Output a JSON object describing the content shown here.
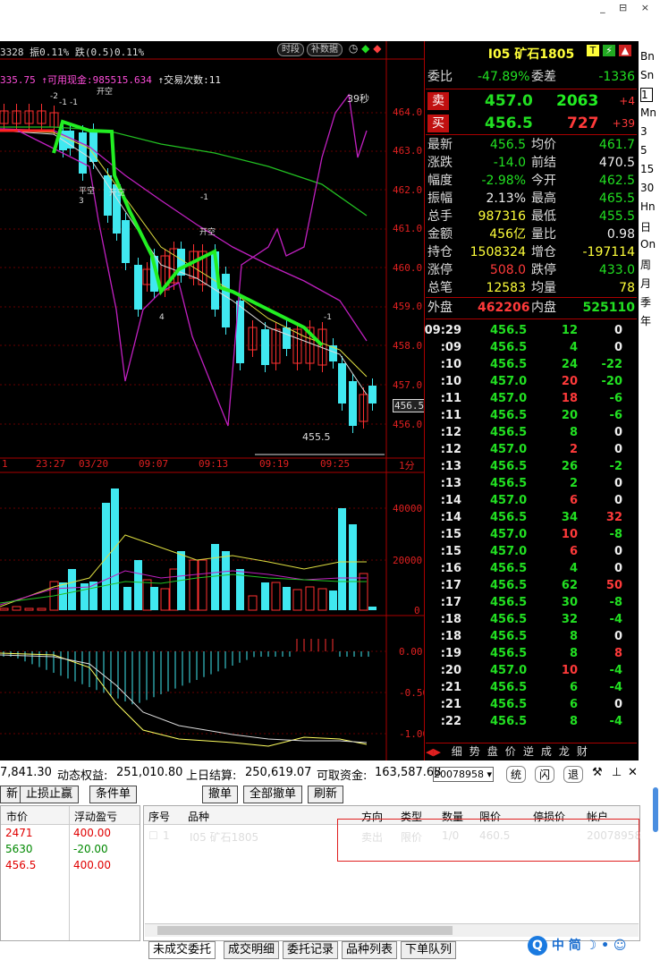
{
  "ticker": {
    "text": "3328 振0.11% 跌(0.5)0.11%",
    "btn_period": "时段",
    "btn_fill": "补数据"
  },
  "account": {
    "a": "335.75",
    "cash_label": "↑可用现金:",
    "cash": "985515.634",
    "trades_label": "↑交易次数:",
    "trades": "11"
  },
  "chart": {
    "y_labels": [
      "464.0",
      "463.0",
      "462.0",
      "461.0",
      "460.0",
      "459.0",
      "458.0",
      "457.0",
      "456.5",
      "456.0"
    ],
    "x_labels": [
      "1",
      "23:27",
      "03/20",
      "09:07",
      "09:13",
      "09:19",
      "09:25",
      "1分"
    ],
    "annot_39": "39秒",
    "annot_low": "455.5",
    "vol_labels": [
      "40000",
      "20000",
      "0"
    ],
    "macd_labels": [
      "0.00",
      "-0.50",
      "-1.00"
    ],
    "trade_marks": [
      "开空",
      "平空",
      "开空",
      "开空"
    ],
    "mark_numbers": [
      "-2",
      "-1",
      "-1",
      "3",
      "4",
      "-1",
      "-1"
    ]
  },
  "quote": {
    "title": "I05 矿石1805",
    "rows": [
      {
        "l1": "委比",
        "v1": "-47.89%",
        "l2": "委差",
        "v2": "-1336",
        "c1": "grn",
        "c2": "grn"
      }
    ],
    "sell": {
      "label": "卖",
      "price": "457.0",
      "vol": "2063",
      "chg": "+4"
    },
    "buy": {
      "label": "买",
      "price": "456.5",
      "vol": "727",
      "chg": "+39"
    },
    "stats": [
      {
        "l1": "最新",
        "v1": "456.5",
        "c1": "grn",
        "l2": "均价",
        "v2": "461.7",
        "c2": "grn"
      },
      {
        "l1": "涨跌",
        "v1": "-14.0",
        "c1": "grn",
        "l2": "前结",
        "v2": "470.5",
        "c2": "wht"
      },
      {
        "l1": "幅度",
        "v1": "-2.98%",
        "c1": "grn",
        "l2": "今开",
        "v2": "462.5",
        "c2": "grn"
      },
      {
        "l1": "振幅",
        "v1": "2.13%",
        "c1": "wht",
        "l2": "最高",
        "v2": "465.5",
        "c2": "grn"
      },
      {
        "l1": "总手",
        "v1": "987316",
        "c1": "yel",
        "l2": "最低",
        "v2": "455.5",
        "c2": "grn"
      },
      {
        "l1": "金额",
        "v1": "456亿",
        "c1": "yel",
        "l2": "量比",
        "v2": "0.98",
        "c2": "wht"
      },
      {
        "l1": "持仓",
        "v1": "1508324",
        "c1": "yel",
        "l2": "增仓",
        "v2": "-197114",
        "c2": "yel"
      },
      {
        "l1": "涨停",
        "v1": "508.0",
        "c1": "red",
        "l2": "跌停",
        "v2": "433.0",
        "c2": "grn"
      },
      {
        "l1": "总笔",
        "v1": "12583",
        "c1": "yel",
        "l2": "均量",
        "v2": "78",
        "c2": "yel"
      }
    ],
    "outer": {
      "l1": "外盘",
      "v1": "462206",
      "l2": "内盘",
      "v2": "525110"
    },
    "ticks": [
      {
        "t": "09:29",
        "p": "456.5",
        "pc": "grn",
        "v": "12",
        "vc": "grn",
        "d": "0",
        "dc": "wht"
      },
      {
        "t": ":09",
        "p": "456.5",
        "pc": "grn",
        "v": "4",
        "vc": "grn",
        "d": "0",
        "dc": "wht"
      },
      {
        "t": ":10",
        "p": "456.5",
        "pc": "grn",
        "v": "24",
        "vc": "grn",
        "d": "-22",
        "dc": "grn"
      },
      {
        "t": ":10",
        "p": "457.0",
        "pc": "grn",
        "v": "20",
        "vc": "red",
        "d": "-20",
        "dc": "grn"
      },
      {
        "t": ":11",
        "p": "457.0",
        "pc": "grn",
        "v": "18",
        "vc": "red",
        "d": "-6",
        "dc": "grn"
      },
      {
        "t": ":11",
        "p": "456.5",
        "pc": "grn",
        "v": "20",
        "vc": "grn",
        "d": "-6",
        "dc": "grn"
      },
      {
        "t": ":12",
        "p": "456.5",
        "pc": "grn",
        "v": "8",
        "vc": "grn",
        "d": "0",
        "dc": "wht"
      },
      {
        "t": ":12",
        "p": "457.0",
        "pc": "grn",
        "v": "2",
        "vc": "red",
        "d": "0",
        "dc": "wht"
      },
      {
        "t": ":13",
        "p": "456.5",
        "pc": "grn",
        "v": "26",
        "vc": "grn",
        "d": "-2",
        "dc": "grn"
      },
      {
        "t": ":13",
        "p": "456.5",
        "pc": "grn",
        "v": "2",
        "vc": "grn",
        "d": "0",
        "dc": "wht"
      },
      {
        "t": ":14",
        "p": "457.0",
        "pc": "grn",
        "v": "6",
        "vc": "red",
        "d": "0",
        "dc": "wht"
      },
      {
        "t": ":14",
        "p": "456.5",
        "pc": "grn",
        "v": "34",
        "vc": "grn",
        "d": "32",
        "dc": "red"
      },
      {
        "t": ":15",
        "p": "457.0",
        "pc": "grn",
        "v": "10",
        "vc": "red",
        "d": "-8",
        "dc": "grn"
      },
      {
        "t": ":15",
        "p": "457.0",
        "pc": "grn",
        "v": "6",
        "vc": "red",
        "d": "0",
        "dc": "wht"
      },
      {
        "t": ":16",
        "p": "456.5",
        "pc": "grn",
        "v": "4",
        "vc": "grn",
        "d": "0",
        "dc": "wht"
      },
      {
        "t": ":17",
        "p": "456.5",
        "pc": "grn",
        "v": "62",
        "vc": "grn",
        "d": "50",
        "dc": "red"
      },
      {
        "t": ":17",
        "p": "456.5",
        "pc": "grn",
        "v": "30",
        "vc": "grn",
        "d": "-8",
        "dc": "grn"
      },
      {
        "t": ":18",
        "p": "456.5",
        "pc": "grn",
        "v": "32",
        "vc": "grn",
        "d": "-4",
        "dc": "grn"
      },
      {
        "t": ":18",
        "p": "456.5",
        "pc": "grn",
        "v": "8",
        "vc": "grn",
        "d": "0",
        "dc": "wht"
      },
      {
        "t": ":19",
        "p": "456.5",
        "pc": "grn",
        "v": "8",
        "vc": "grn",
        "d": "8",
        "dc": "red"
      },
      {
        "t": ":20",
        "p": "457.0",
        "pc": "grn",
        "v": "10",
        "vc": "red",
        "d": "-4",
        "dc": "grn"
      },
      {
        "t": ":21",
        "p": "456.5",
        "pc": "grn",
        "v": "6",
        "vc": "grn",
        "d": "-4",
        "dc": "grn"
      },
      {
        "t": ":21",
        "p": "456.5",
        "pc": "grn",
        "v": "6",
        "vc": "grn",
        "d": "0",
        "dc": "wht"
      },
      {
        "t": ":22",
        "p": "456.5",
        "pc": "grn",
        "v": "8",
        "vc": "grn",
        "d": "-4",
        "dc": "grn"
      }
    ],
    "tabs": [
      "细",
      "势",
      "盘",
      "价",
      "逆",
      "成",
      "龙",
      "财"
    ]
  },
  "sidebar_tabs": [
    "Bn",
    "Sn",
    "1",
    "Mn",
    "3",
    "5",
    "15",
    "30",
    "Hn",
    "日",
    "On",
    "周",
    "月",
    "季",
    "年"
  ],
  "account_bar": {
    "eq_prefix": "7,841.30",
    "dyn_label": "动态权益:",
    "dyn": "251,010.80",
    "prev_label": "上日结算:",
    "prev": "250,619.07",
    "avail_label": "可取资金:",
    "avail": "163,587.68",
    "acct": "20078958",
    "btn1": "统",
    "btn2": "闪",
    "btn3": "退"
  },
  "left_buttons": [
    "新",
    "止损止赢",
    "条件单"
  ],
  "right_buttons": [
    "撤单",
    "全部撤单",
    "刷新"
  ],
  "positions": {
    "h1": "市价",
    "h2": "浮动盈亏",
    "rows": [
      {
        "p": "2471",
        "pc": "red",
        "g": "400.00",
        "gc": "red"
      },
      {
        "p": "5630",
        "pc": "grn",
        "g": "-20.00",
        "gc": "grn"
      },
      {
        "p": "456.5",
        "pc": "red",
        "g": "400.00",
        "gc": "red"
      }
    ]
  },
  "orders": {
    "headers": [
      "序号",
      "品种",
      "方向",
      "类型",
      "数量",
      "限价",
      "停损价",
      "帐户"
    ],
    "row": {
      "no": "1",
      "name": "I05 矿石1805",
      "dir": "卖出",
      "type": "限价",
      "qty": "1/0",
      "limit": "460.5",
      "stop": "",
      "acct": "20078958"
    }
  },
  "bottom_tabs": [
    "未成交委托",
    "成交明细",
    "委托记录",
    "品种列表",
    "下单队列"
  ],
  "ime": {
    "lang": "中",
    "mode": "简"
  }
}
